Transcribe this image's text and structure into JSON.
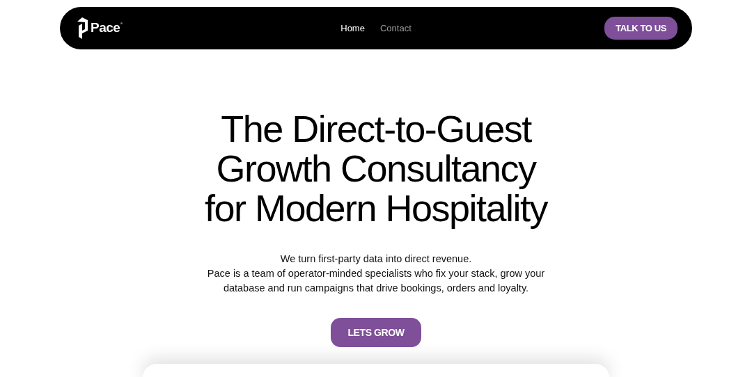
{
  "navbar": {
    "brand": "Pace",
    "links": [
      {
        "label": "Home",
        "selected": true
      },
      {
        "label": "Contact",
        "selected": false
      }
    ],
    "cta": "TALK TO US"
  },
  "hero": {
    "heading": [
      "The Direct-to-Guest",
      "Growth Consultancy",
      "for Modern Hospitality"
    ],
    "lead": "We turn first-party data into direct revenue.",
    "description": "Pace is a team of operator-minded specialists who fix your stack, grow your database and run campaigns that drive bookings, orders and loyalty.",
    "button": "LETS GROW"
  }
}
